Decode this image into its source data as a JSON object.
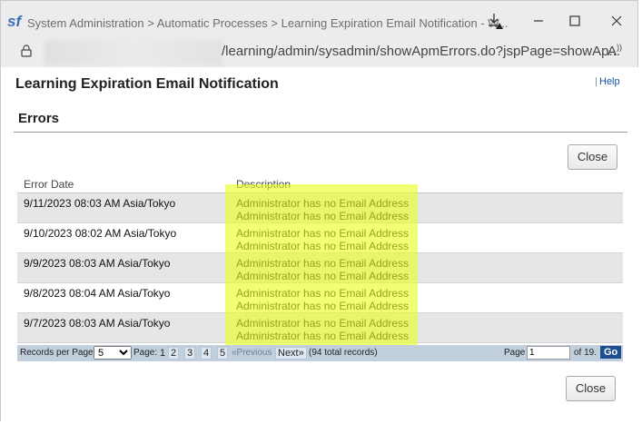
{
  "window": {
    "logo": "sf",
    "title": "System Administration > Automatic Processes > Learning Expiration Email Notification - W..."
  },
  "address": {
    "url": "/learning/admin/sysadmin/showApmErrors.do?jspPage=showAp..."
  },
  "page": {
    "title": "Learning Expiration Email Notification",
    "help_sep": "|",
    "help": "Help",
    "section": "Errors",
    "close_top": "Close",
    "close_bottom": "Close"
  },
  "table": {
    "headers": [
      "Error Date",
      "Description"
    ],
    "rows": [
      {
        "date": "9/11/2023 08:03 AM Asia/Tokyo",
        "desc1": "Administrator has no Email Address",
        "desc2": "Administrator has no Email Address"
      },
      {
        "date": "9/10/2023 08:02 AM Asia/Tokyo",
        "desc1": "Administrator has no Email Address",
        "desc2": "Administrator has no Email Address"
      },
      {
        "date": "9/9/2023 08:03 AM Asia/Tokyo",
        "desc1": "Administrator has no Email Address",
        "desc2": "Administrator has no Email Address"
      },
      {
        "date": "9/8/2023 08:04 AM Asia/Tokyo",
        "desc1": "Administrator has no Email Address",
        "desc2": "Administrator has no Email Address"
      },
      {
        "date": "9/7/2023 08:03 AM Asia/Tokyo",
        "desc1": "Administrator has no Email Address",
        "desc2": "Administrator has no Email Address"
      }
    ]
  },
  "pager": {
    "records_label": "Records per Page",
    "records_value": "5",
    "page_label": "Page:",
    "pages": [
      "1",
      "2",
      "3",
      "4",
      "5"
    ],
    "prev": "«Previous",
    "next": "Next»",
    "total": "(94 total records)",
    "page_label2": "Page",
    "page_value": "1",
    "of": "of 19.",
    "go": "Go"
  }
}
